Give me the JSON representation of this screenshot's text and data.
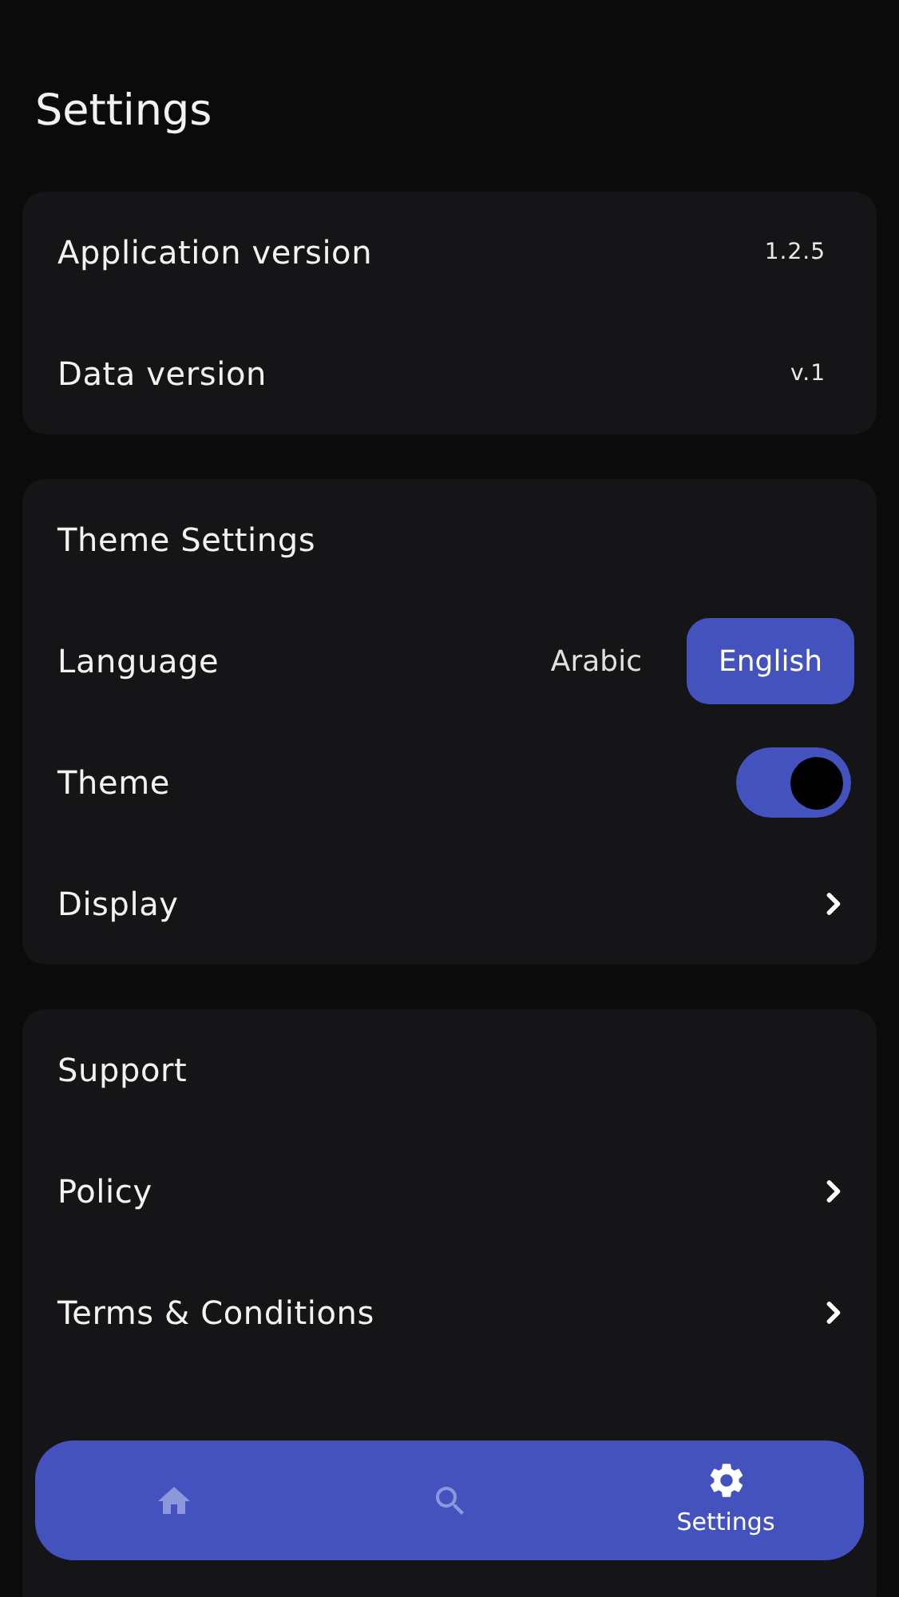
{
  "title": "Settings",
  "sections": [
    {
      "items": [
        {
          "kind": "value",
          "label": "Application version",
          "value": "1.2.5"
        },
        {
          "kind": "value",
          "label": "Data version",
          "value": "v.1"
        }
      ]
    },
    {
      "heading": "Theme Settings",
      "items": [
        {
          "kind": "choice",
          "label": "Language",
          "options": [
            {
              "label": "Arabic",
              "selected": false
            },
            {
              "label": "English",
              "selected": true
            }
          ]
        },
        {
          "kind": "switch",
          "label": "Theme",
          "on": true
        },
        {
          "kind": "link",
          "label": "Display"
        }
      ]
    },
    {
      "heading": "Support",
      "items": [
        {
          "kind": "link",
          "label": "Policy"
        },
        {
          "kind": "link",
          "label": "Terms & Conditions"
        },
        {
          "kind": "covered"
        },
        {
          "kind": "covered"
        }
      ]
    }
  ],
  "nav": [
    {
      "kind": "home",
      "selected": false
    },
    {
      "kind": "search",
      "selected": false
    },
    {
      "kind": "settings",
      "label": "Settings",
      "selected": true
    }
  ]
}
